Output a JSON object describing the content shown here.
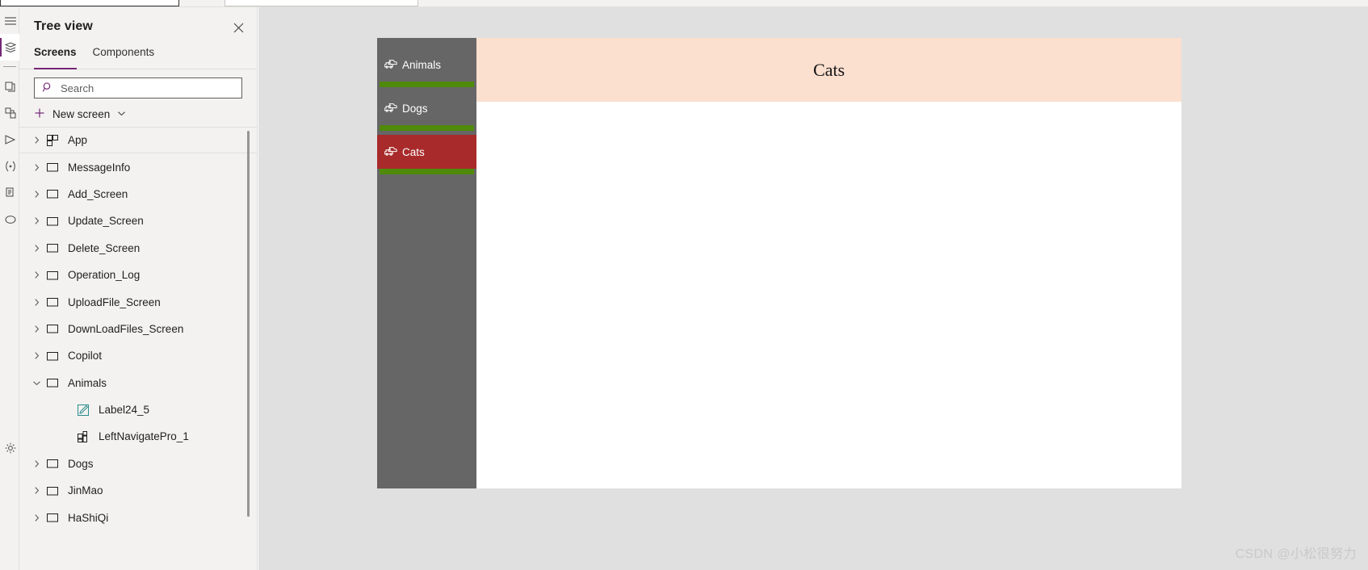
{
  "left_rail": {
    "items": [
      {
        "name": "menu-icon",
        "label": "Menu",
        "selected": false
      },
      {
        "name": "tree-view-icon",
        "label": "Tree view",
        "selected": true
      },
      {
        "name": "divider",
        "label": "",
        "selected": false
      },
      {
        "name": "insert-icon",
        "label": "Insert",
        "selected": false
      },
      {
        "name": "data-icon",
        "label": "Data",
        "selected": false
      },
      {
        "name": "media-icon",
        "label": "Media",
        "selected": false
      },
      {
        "name": "variables-icon",
        "label": "Variables",
        "selected": false
      },
      {
        "name": "search-results-icon",
        "label": "Search",
        "selected": false
      },
      {
        "name": "copilot-icon",
        "label": "Copilot",
        "selected": false
      },
      {
        "name": "settings-icon",
        "label": "Settings",
        "selected": false
      }
    ]
  },
  "tree_panel": {
    "title": "Tree view",
    "close_label": "✕",
    "tabs": [
      {
        "label": "Screens",
        "active": true
      },
      {
        "label": "Components",
        "active": false
      }
    ],
    "search": {
      "value": "",
      "placeholder": "Search"
    },
    "new_screen": {
      "label": "New screen"
    },
    "items": [
      {
        "label": "App",
        "icon": "app-icon",
        "expandable": true,
        "expanded": false,
        "level": 0
      },
      {
        "label": "MessageInfo",
        "icon": "screen-icon",
        "expandable": true,
        "expanded": false,
        "level": 0
      },
      {
        "label": "Add_Screen",
        "icon": "screen-icon",
        "expandable": true,
        "expanded": false,
        "level": 0
      },
      {
        "label": "Update_Screen",
        "icon": "screen-icon",
        "expandable": true,
        "expanded": false,
        "level": 0
      },
      {
        "label": "Delete_Screen",
        "icon": "screen-icon",
        "expandable": true,
        "expanded": false,
        "level": 0
      },
      {
        "label": "Operation_Log",
        "icon": "screen-icon",
        "expandable": true,
        "expanded": false,
        "level": 0
      },
      {
        "label": "UploadFile_Screen",
        "icon": "screen-icon",
        "expandable": true,
        "expanded": false,
        "level": 0
      },
      {
        "label": "DownLoadFiles_Screen",
        "icon": "screen-icon",
        "expandable": true,
        "expanded": false,
        "level": 0
      },
      {
        "label": "Copilot",
        "icon": "screen-icon",
        "expandable": true,
        "expanded": false,
        "level": 0
      },
      {
        "label": "Animals",
        "icon": "screen-icon",
        "expandable": true,
        "expanded": true,
        "level": 0
      },
      {
        "label": "Label24_5",
        "icon": "label-icon",
        "expandable": false,
        "expanded": false,
        "level": 1
      },
      {
        "label": "LeftNavigatePro_1",
        "icon": "component-icon",
        "expandable": false,
        "expanded": false,
        "level": 1
      },
      {
        "label": "Dogs",
        "icon": "screen-icon",
        "expandable": true,
        "expanded": false,
        "level": 0
      },
      {
        "label": "JinMao",
        "icon": "screen-icon",
        "expandable": true,
        "expanded": false,
        "level": 0
      },
      {
        "label": "HaShiQi",
        "icon": "screen-icon",
        "expandable": true,
        "expanded": false,
        "level": 0
      }
    ]
  },
  "canvas": {
    "title": "Cats",
    "nav_items": [
      {
        "label": "Animals",
        "icon": "vehicles-icon",
        "selected": false
      },
      {
        "label": "Dogs",
        "icon": "vehicles-icon",
        "selected": false
      },
      {
        "label": "Cats",
        "icon": "vehicles-icon",
        "selected": true
      }
    ]
  },
  "colors": {
    "accent_purple": "#742774",
    "nav_background": "#666666",
    "nav_selected": "#a82a2a",
    "nav_separator": "#4f8a0b",
    "title_band": "#fbdfcf",
    "stage_background": "#e0e0e0"
  },
  "watermark": {
    "text": "CSDN @小松很努力"
  }
}
